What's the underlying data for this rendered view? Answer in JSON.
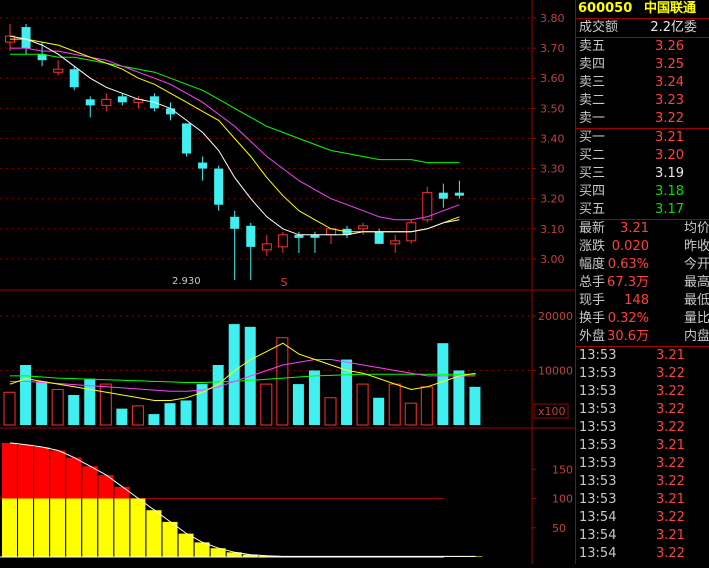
{
  "stock": {
    "code": "600050",
    "name": "中国联通"
  },
  "price_axis": [
    "3.80",
    "3.70",
    "3.60",
    "3.50",
    "3.40",
    "3.30",
    "3.20",
    "3.10",
    "3.00"
  ],
  "vol_axis": [
    "20000",
    "10000"
  ],
  "vol_unit": "x100",
  "ind_axis": [
    "150",
    "100",
    "50"
  ],
  "low_annot": "2.930",
  "signal_mark": "S",
  "colors": {
    "up": "#ff3030",
    "down": "#40f0f0",
    "ma5": "#ffffff",
    "ma10": "#ffff00",
    "ma20": "#ff40ff",
    "ma30": "#00ff00",
    "grid": "#a00000",
    "axis_text": "#c04040"
  },
  "info": {
    "turnover": {
      "label": "成交额",
      "value": "2.2亿",
      "extra": "委"
    },
    "asks": [
      {
        "label": "卖五",
        "price": "3.26"
      },
      {
        "label": "卖四",
        "price": "3.25"
      },
      {
        "label": "卖三",
        "price": "3.24"
      },
      {
        "label": "卖二",
        "price": "3.23"
      },
      {
        "label": "卖一",
        "price": "3.22"
      }
    ],
    "bids": [
      {
        "label": "买一",
        "price": "3.21",
        "cls": "red"
      },
      {
        "label": "买二",
        "price": "3.20",
        "cls": "red"
      },
      {
        "label": "买三",
        "price": "3.19",
        "cls": "white"
      },
      {
        "label": "买四",
        "price": "3.18",
        "cls": "green"
      },
      {
        "label": "买五",
        "price": "3.17",
        "cls": "green"
      }
    ],
    "stats": [
      {
        "label": "最新",
        "value": "3.21",
        "extra": "均价",
        "cls": "red"
      },
      {
        "label": "涨跌",
        "value": "0.020",
        "extra": "昨收",
        "cls": "red"
      },
      {
        "label": "幅度",
        "value": "0.63%",
        "extra": "今开",
        "cls": "red"
      },
      {
        "label": "总手",
        "value": "67.3万",
        "extra": "最高",
        "cls": "red"
      },
      {
        "label": "现手",
        "value": "148",
        "extra": "最低",
        "cls": "red"
      },
      {
        "label": "换手",
        "value": "0.32%",
        "extra": "量比",
        "cls": "red"
      },
      {
        "label": "外盘",
        "value": "30.6万",
        "extra": "内盘",
        "cls": "red"
      }
    ],
    "ticks": [
      {
        "time": "13:53",
        "price": "3.21"
      },
      {
        "time": "13:53",
        "price": "3.22"
      },
      {
        "time": "13:53",
        "price": "3.22"
      },
      {
        "time": "13:53",
        "price": "3.22"
      },
      {
        "time": "13:53",
        "price": "3.22"
      },
      {
        "time": "13:53",
        "price": "3.21"
      },
      {
        "time": "13:53",
        "price": "3.22"
      },
      {
        "time": "13:53",
        "price": "3.22"
      },
      {
        "time": "13:53",
        "price": "3.21"
      },
      {
        "time": "13:54",
        "price": "3.22"
      },
      {
        "time": "13:54",
        "price": "3.21"
      },
      {
        "time": "13:54",
        "price": "3.22"
      }
    ]
  },
  "chart_data": {
    "type": "candlestick",
    "y_range": [
      2.93,
      3.82
    ],
    "candles": [
      {
        "o": 3.72,
        "h": 3.78,
        "l": 3.69,
        "c": 3.74
      },
      {
        "o": 3.77,
        "h": 3.78,
        "l": 3.68,
        "c": 3.7
      },
      {
        "o": 3.68,
        "h": 3.72,
        "l": 3.64,
        "c": 3.66
      },
      {
        "o": 3.62,
        "h": 3.66,
        "l": 3.61,
        "c": 3.63
      },
      {
        "o": 3.63,
        "h": 3.64,
        "l": 3.56,
        "c": 3.57
      },
      {
        "o": 3.53,
        "h": 3.54,
        "l": 3.47,
        "c": 3.51
      },
      {
        "o": 3.51,
        "h": 3.55,
        "l": 3.49,
        "c": 3.53
      },
      {
        "o": 3.54,
        "h": 3.55,
        "l": 3.51,
        "c": 3.52
      },
      {
        "o": 3.52,
        "h": 3.54,
        "l": 3.5,
        "c": 3.53
      },
      {
        "o": 3.54,
        "h": 3.55,
        "l": 3.49,
        "c": 3.5
      },
      {
        "o": 3.5,
        "h": 3.52,
        "l": 3.46,
        "c": 3.48
      },
      {
        "o": 3.45,
        "h": 3.45,
        "l": 3.34,
        "c": 3.35
      },
      {
        "o": 3.32,
        "h": 3.34,
        "l": 3.26,
        "c": 3.3
      },
      {
        "o": 3.3,
        "h": 3.31,
        "l": 3.16,
        "c": 3.18
      },
      {
        "o": 3.14,
        "h": 3.16,
        "l": 2.93,
        "c": 3.1
      },
      {
        "o": 3.11,
        "h": 3.12,
        "l": 2.93,
        "c": 3.04
      },
      {
        "o": 3.03,
        "h": 3.08,
        "l": 3.01,
        "c": 3.05
      },
      {
        "o": 3.04,
        "h": 3.09,
        "l": 3.02,
        "c": 3.08
      },
      {
        "o": 3.08,
        "h": 3.09,
        "l": 3.02,
        "c": 3.07
      },
      {
        "o": 3.08,
        "h": 3.09,
        "l": 3.02,
        "c": 3.07
      },
      {
        "o": 3.08,
        "h": 3.1,
        "l": 3.05,
        "c": 3.1
      },
      {
        "o": 3.1,
        "h": 3.11,
        "l": 3.07,
        "c": 3.08
      },
      {
        "o": 3.1,
        "h": 3.12,
        "l": 3.08,
        "c": 3.11
      },
      {
        "o": 3.09,
        "h": 3.1,
        "l": 3.06,
        "c": 3.05
      },
      {
        "o": 3.05,
        "h": 3.08,
        "l": 3.02,
        "c": 3.06
      },
      {
        "o": 3.06,
        "h": 3.13,
        "l": 3.05,
        "c": 3.12
      },
      {
        "o": 3.13,
        "h": 3.24,
        "l": 3.12,
        "c": 3.22
      },
      {
        "o": 3.22,
        "h": 3.25,
        "l": 3.17,
        "c": 3.2
      },
      {
        "o": 3.22,
        "h": 3.26,
        "l": 3.2,
        "c": 3.21
      }
    ],
    "ma5": [
      3.74,
      3.73,
      3.71,
      3.68,
      3.64,
      3.6,
      3.57,
      3.55,
      3.53,
      3.52,
      3.5,
      3.46,
      3.42,
      3.36,
      3.27,
      3.2,
      3.14,
      3.1,
      3.08,
      3.08,
      3.08,
      3.08,
      3.09,
      3.09,
      3.09,
      3.09,
      3.1,
      3.12,
      3.13
    ],
    "ma10": [
      3.73,
      3.73,
      3.72,
      3.71,
      3.69,
      3.67,
      3.65,
      3.63,
      3.6,
      3.58,
      3.55,
      3.52,
      3.49,
      3.46,
      3.4,
      3.34,
      3.27,
      3.21,
      3.16,
      3.13,
      3.1,
      3.09,
      3.09,
      3.09,
      3.09,
      3.09,
      3.1,
      3.12,
      3.14
    ],
    "ma20": [
      3.7,
      3.7,
      3.69,
      3.69,
      3.68,
      3.67,
      3.66,
      3.64,
      3.62,
      3.6,
      3.58,
      3.55,
      3.52,
      3.48,
      3.44,
      3.39,
      3.34,
      3.3,
      3.26,
      3.23,
      3.2,
      3.18,
      3.16,
      3.14,
      3.13,
      3.13,
      3.14,
      3.16,
      3.18
    ],
    "ma30": [
      3.68,
      3.68,
      3.68,
      3.67,
      3.67,
      3.66,
      3.65,
      3.64,
      3.63,
      3.62,
      3.6,
      3.58,
      3.56,
      3.53,
      3.5,
      3.47,
      3.44,
      3.42,
      3.4,
      3.38,
      3.36,
      3.35,
      3.34,
      3.33,
      3.33,
      3.33,
      3.32,
      3.32,
      3.32
    ],
    "volume_range": [
      0,
      22000
    ],
    "volumes": [
      6000,
      11000,
      8000,
      6500,
      5500,
      8500,
      7500,
      3000,
      3500,
      2000,
      4000,
      4500,
      7500,
      11000,
      18500,
      18000,
      7500,
      16000,
      7500,
      10000,
      5000,
      12000,
      7500,
      5000,
      7500,
      4000,
      7000,
      15000,
      10000,
      7000
    ],
    "vol_ma1": [
      7500,
      8500,
      8000,
      7500,
      7000,
      6500,
      6000,
      5500,
      5000,
      4500,
      4500,
      5000,
      6000,
      7500,
      10000,
      12000,
      13500,
      15000,
      13000,
      12000,
      11000,
      10000,
      9500,
      8500,
      7500,
      6500,
      7000,
      8000,
      9000,
      9500
    ],
    "vol_ma2": [
      8000,
      8000,
      7800,
      7600,
      7400,
      7200,
      7000,
      6800,
      6600,
      6400,
      6200,
      6200,
      6400,
      7000,
      8000,
      9000,
      10000,
      11000,
      11500,
      12000,
      12000,
      11500,
      11000,
      10500,
      10000,
      9500,
      9000,
      9000,
      9000,
      9000
    ],
    "vol_ma3": [
      9000,
      9000,
      8800,
      8600,
      8500,
      8400,
      8300,
      8200,
      8100,
      8000,
      7900,
      7800,
      7800,
      7900,
      8000,
      8200,
      8400,
      8600,
      8800,
      9000,
      9100,
      9200,
      9300,
      9300,
      9300,
      9300,
      9300,
      9300,
      9300,
      9300
    ],
    "indicator_range": [
      0,
      200
    ],
    "indicator": [
      195,
      192,
      188,
      182,
      170,
      155,
      140,
      120,
      100,
      80,
      60,
      40,
      25,
      15,
      8,
      4,
      2,
      1,
      1,
      1,
      1,
      1,
      1,
      1,
      1,
      1,
      1,
      1,
      1,
      1
    ]
  }
}
